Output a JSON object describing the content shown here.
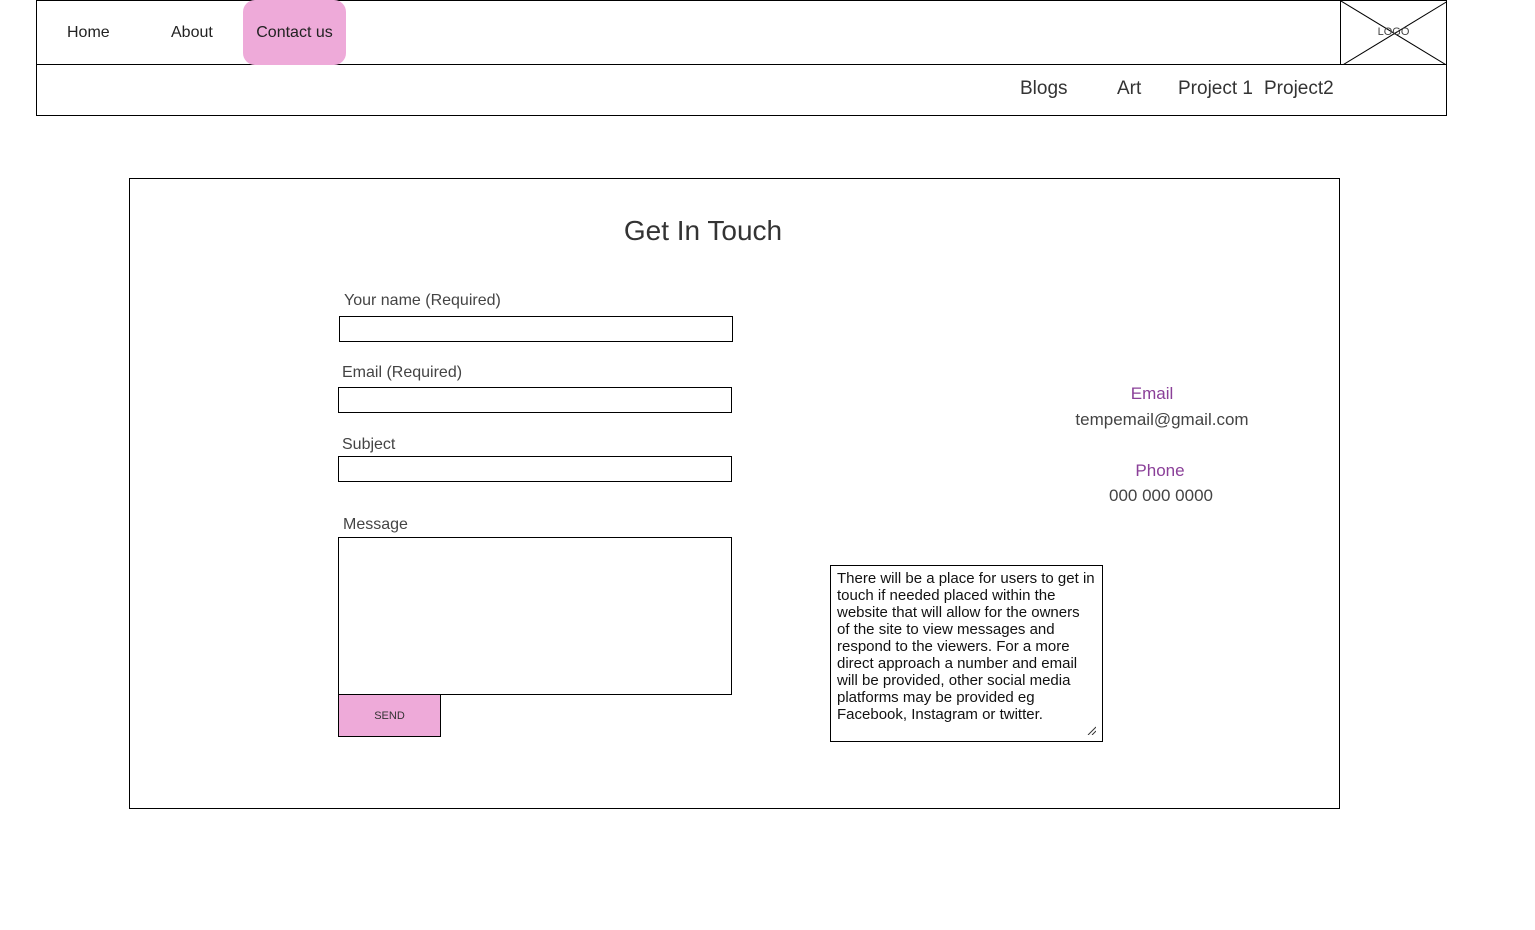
{
  "nav": {
    "home": "Home",
    "about": "About",
    "contact": "Contact us",
    "logo": "LOGO"
  },
  "subnav": {
    "blogs": "Blogs",
    "art": "Art",
    "project1": "Project 1",
    "project2": "Project2"
  },
  "contact": {
    "title": "Get In Touch",
    "name_label": "Your name (Required)",
    "name_value": "",
    "email_label": "Email (Required)",
    "email_value": "",
    "subject_label": "Subject",
    "subject_value": "",
    "message_label": "Message",
    "message_value": "",
    "send_label": "SEND"
  },
  "info": {
    "email_heading": "Email",
    "email_value": "tempemail@gmail.com",
    "phone_heading": "Phone",
    "phone_value": "000 000 0000",
    "note": "There will be a place for users to get in touch if needed placed within the website that will allow for the owners of the site to view messages and respond to the viewers. For a more direct approach a number and email will be provided, other social media platforms may be provided eg Facebook, Instagram or twitter."
  },
  "colors": {
    "accent_pink": "#eeaad9",
    "heading_purple": "#8a3f98"
  }
}
